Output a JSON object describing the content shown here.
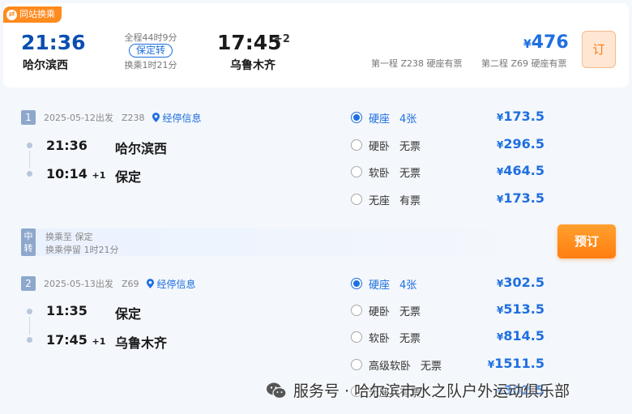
{
  "summary": {
    "tag": "同站换乘",
    "dep_time": "21:36",
    "dep_station": "哈尔滨西",
    "duration": "全程44时9分",
    "badge": "保定转",
    "transfer_time": "换乘1时21分",
    "arr_time": "17:45",
    "arr_plus": "+2",
    "arr_station": "乌鲁木齐",
    "price_symbol": "¥",
    "price": "476",
    "leg1": "第一程 Z238 硬座有票",
    "leg2": "第二程 Z69 硬座有票",
    "order_label": "订"
  },
  "segments": [
    {
      "num": "1",
      "date": "2025-05-12出发",
      "train": "Z238",
      "stops_label": "经停信息",
      "dep_time": "21:36",
      "dep_plus": "",
      "dep_station": "哈尔滨西",
      "arr_time": "10:14",
      "arr_plus": "+1",
      "arr_station": "保定",
      "seats": [
        {
          "name": "硬座",
          "avail": "4张",
          "price": "173.5",
          "selected": true
        },
        {
          "name": "硬卧",
          "avail": "无票",
          "price": "296.5",
          "selected": false
        },
        {
          "name": "软卧",
          "avail": "无票",
          "price": "464.5",
          "selected": false
        },
        {
          "name": "无座",
          "avail": "有票",
          "price": "173.5",
          "selected": false
        }
      ]
    },
    {
      "num": "2",
      "date": "2025-05-13出发",
      "train": "Z69",
      "stops_label": "经停信息",
      "dep_time": "11:35",
      "dep_plus": "",
      "dep_station": "保定",
      "arr_time": "17:45",
      "arr_plus": "+1",
      "arr_station": "乌鲁木齐",
      "seats": [
        {
          "name": "硬座",
          "avail": "4张",
          "price": "302.5",
          "selected": true
        },
        {
          "name": "硬卧",
          "avail": "无票",
          "price": "513.5",
          "selected": false
        },
        {
          "name": "软卧",
          "avail": "无票",
          "price": "814.5",
          "selected": false
        },
        {
          "name": "高级软卧",
          "avail": "无票",
          "price": "1511.5",
          "selected": false
        },
        {
          "name": "无座",
          "avail": "有票",
          "price": "302.5",
          "selected": false
        }
      ]
    }
  ],
  "transfer": {
    "badge_top": "中",
    "badge_bottom": "转",
    "line1": "换乘至 保定",
    "line2": "换乘停留 1时21分"
  },
  "book_button": "预订",
  "currency": "¥",
  "watermark": "服务号 · 哈尔滨市水之队户外运动俱乐部",
  "colors": {
    "accent": "#1e6fe0",
    "orange": "#ff8a1e"
  }
}
